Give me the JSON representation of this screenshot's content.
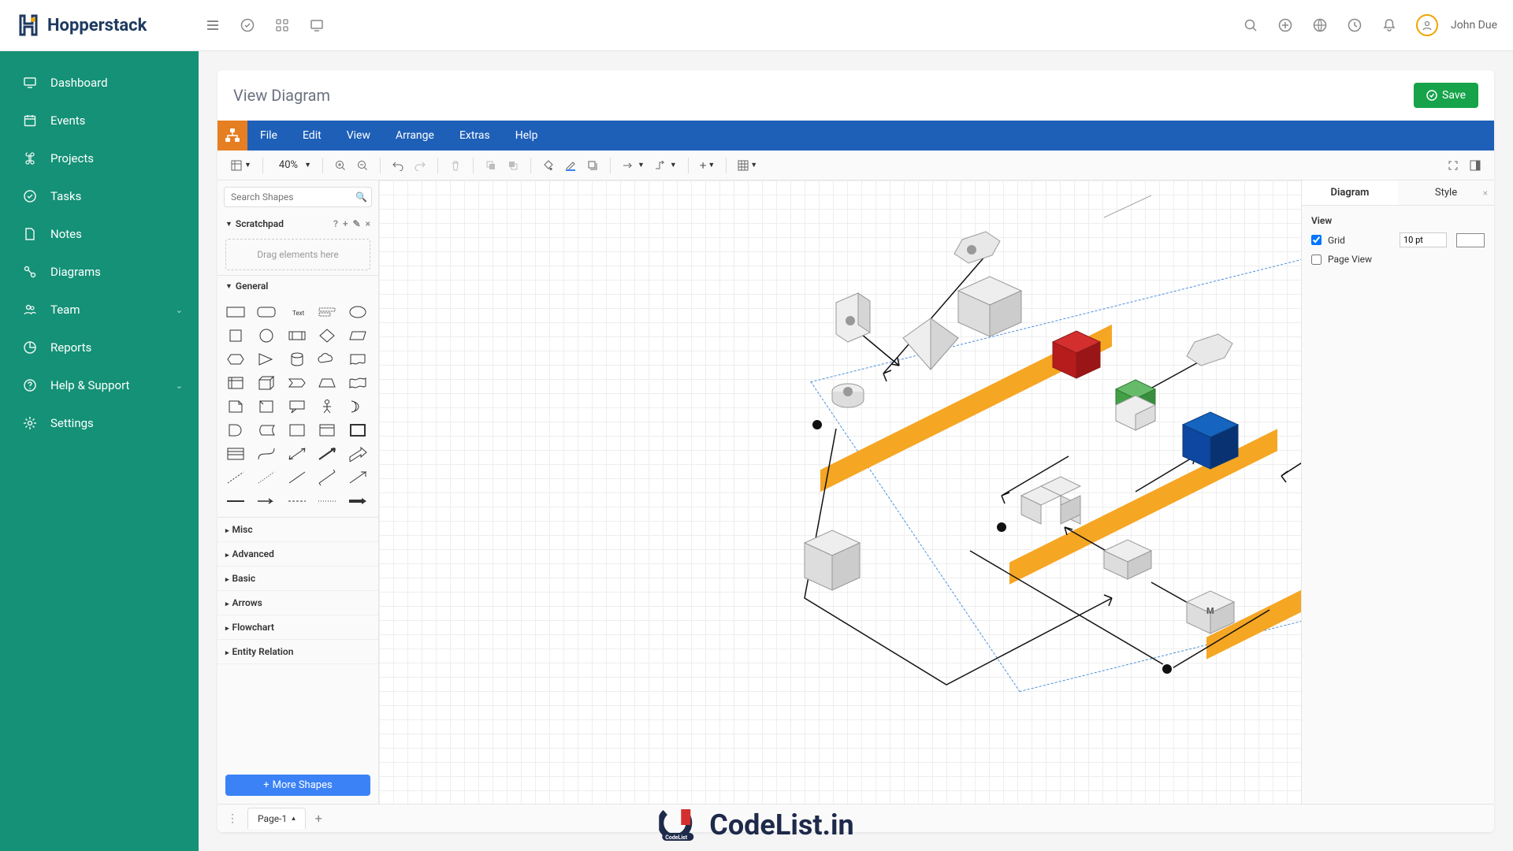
{
  "header": {
    "brand": "Hopperstack",
    "user": "John Due"
  },
  "sidebar": {
    "items": [
      {
        "label": "Dashboard"
      },
      {
        "label": "Events"
      },
      {
        "label": "Projects"
      },
      {
        "label": "Tasks"
      },
      {
        "label": "Notes"
      },
      {
        "label": "Diagrams"
      },
      {
        "label": "Team"
      },
      {
        "label": "Reports"
      },
      {
        "label": "Help & Support"
      },
      {
        "label": "Settings"
      }
    ]
  },
  "page": {
    "title": "View Diagram",
    "save_label": "Save"
  },
  "menubar": {
    "items": [
      "File",
      "Edit",
      "View",
      "Arrange",
      "Extras",
      "Help"
    ]
  },
  "toolbar": {
    "zoom": "40%"
  },
  "left_panel": {
    "search_placeholder": "Search Shapes",
    "scratchpad_label": "Scratchpad",
    "scratch_drop": "Drag elements here",
    "general_label": "General",
    "categories": [
      "Misc",
      "Advanced",
      "Basic",
      "Arrows",
      "Flowchart",
      "Entity Relation"
    ],
    "more_shapes": "More Shapes"
  },
  "right_panel": {
    "tabs": {
      "diagram": "Diagram",
      "style": "Style"
    },
    "view_label": "View",
    "grid_label": "Grid",
    "pageview_label": "Page View",
    "grid_value": "10 pt"
  },
  "bottom": {
    "page_label": "Page-1"
  },
  "watermark": {
    "text": "CodeList.in"
  }
}
